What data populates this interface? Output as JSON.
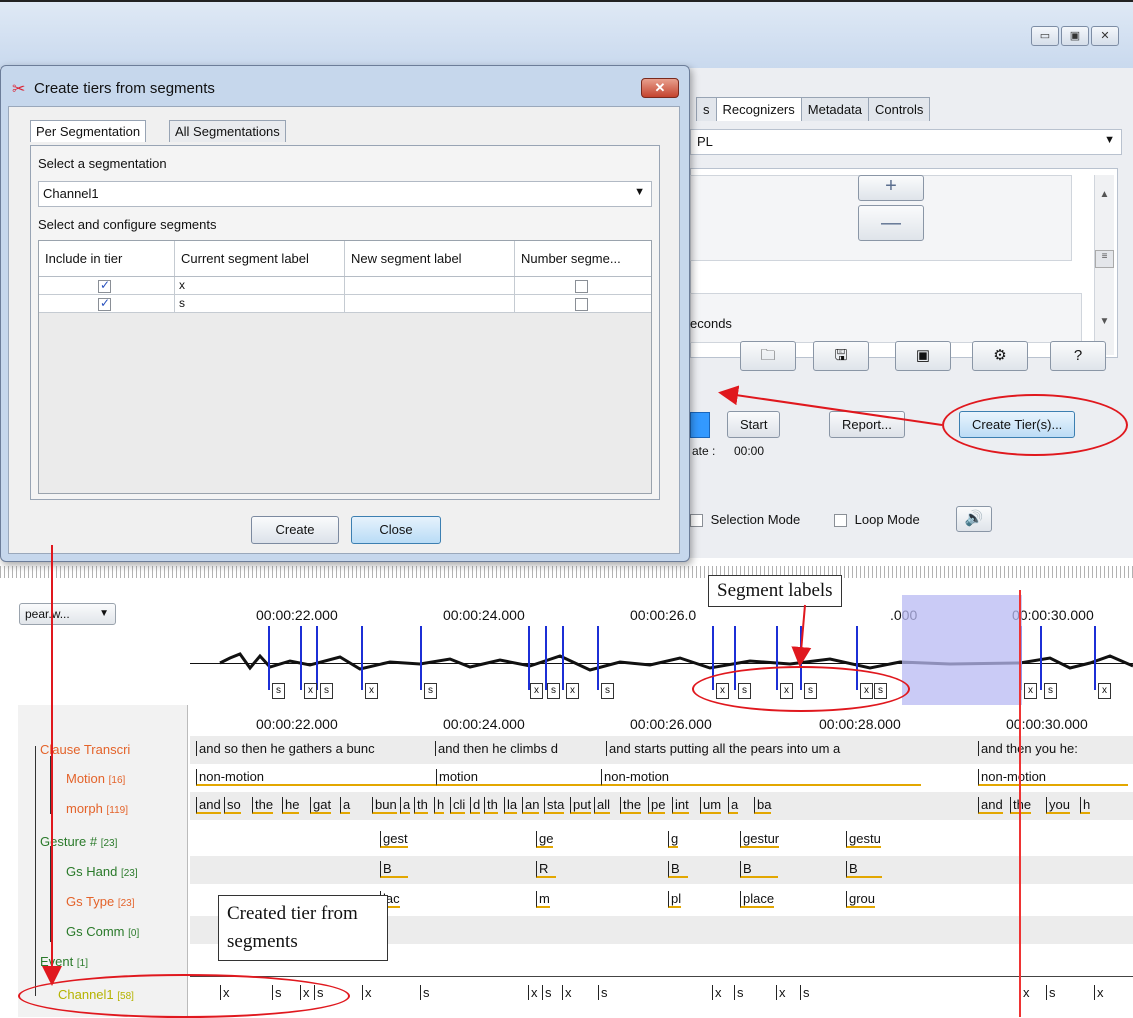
{
  "window_controls": {
    "minimize": "▭",
    "maximize": "▣",
    "close": "✕"
  },
  "main_window": {
    "tabs": [
      "s",
      "Recognizers",
      "Metadata",
      "Controls"
    ],
    "recognizer_select": "PL",
    "plus": "+",
    "minus": "—",
    "seconds_text": "econds",
    "toolbar_icons": [
      "folder-icon",
      "save-icon",
      "window-icon",
      "gear-icon",
      "help-icon"
    ],
    "start_label": "Start",
    "report_label": "Report...",
    "create_tiers_label": "Create Tier(s)...",
    "rate_label": "ate :",
    "rate_value": "00:00",
    "selection_mode_label": "Selection Mode",
    "loop_mode_label": "Loop Mode"
  },
  "dialog": {
    "title": "Create tiers from segments",
    "close": "✕",
    "tabs": [
      "Per Segmentation",
      "All Segmentations"
    ],
    "select_segmentation_label": "Select a segmentation",
    "segmentation_value": "Channel1",
    "configure_label": "Select and configure segments",
    "columns": [
      "Include in tier",
      "Current segment label",
      "New segment label",
      "Number segme..."
    ],
    "rows": [
      {
        "include": true,
        "current": "x",
        "new": "",
        "number": false
      },
      {
        "include": true,
        "current": "s",
        "new": "",
        "number": false
      }
    ],
    "create_label": "Create",
    "close_label": "Close"
  },
  "timeline": {
    "combo_value": "pear.w...",
    "times": [
      "00:00:22.000",
      "00:00:24.000",
      "00:00:26.0",
      ".000",
      "00:00:30.000"
    ],
    "tier_times": [
      "00:00:22.000",
      "00:00:24.000",
      "00:00:26.000",
      "00:00:28.000",
      "00:00:30.000"
    ],
    "wave_segment_labels": [
      "s",
      "x",
      "s",
      "x",
      "s",
      "x",
      "s",
      "x",
      "s",
      "x",
      "s",
      "x",
      "s",
      "x",
      "s",
      "x",
      "s",
      "x"
    ],
    "tiers": [
      {
        "name": "Clause Transcri",
        "count": ""
      },
      {
        "name": "Motion",
        "count": "[16]"
      },
      {
        "name": "morph",
        "count": "[119]"
      },
      {
        "name": "Gesture #",
        "count": "[23]"
      },
      {
        "name": "Gs Hand",
        "count": "[23]"
      },
      {
        "name": "Gs Type",
        "count": "[23]"
      },
      {
        "name": "Gs Comm",
        "count": "[0]"
      },
      {
        "name": "Event",
        "count": "[1]"
      },
      {
        "name": "Channel1",
        "count": "[58]"
      }
    ],
    "clause": [
      "and so then he gathers a bunc",
      "and then he climbs d",
      "and starts putting all the pears into um a",
      "and then you he:"
    ],
    "motion": [
      "non-motion",
      "motion",
      "non-motion",
      "non-motion"
    ],
    "morph": [
      "and",
      "so",
      "the",
      "he",
      "gat",
      "a",
      "bun",
      "a",
      "th",
      "h",
      "cli",
      "d",
      "th",
      "la",
      "an",
      "sta",
      "put",
      "all",
      "the",
      "pe",
      "int",
      "um",
      "a",
      "ba",
      "and",
      "the",
      "you",
      "h"
    ],
    "gesture": [
      "gest",
      "ge",
      "g",
      "gestur",
      "gestu"
    ],
    "gs_hand": [
      "B",
      "R",
      "B",
      "B",
      "B"
    ],
    "gs_type": [
      "lac",
      "m",
      "pl",
      "place",
      "grou"
    ],
    "channel1": [
      "x",
      "s",
      "x",
      "s",
      "x",
      "s",
      "x",
      "s",
      "x",
      "s",
      "x",
      "s",
      "x",
      "s",
      "x",
      "s",
      "x"
    ]
  },
  "annotations": {
    "segment_labels": "Segment labels",
    "created_tier": "Created tier from segments"
  },
  "colors": {
    "accent_red": "#e0181e",
    "segment_blue": "#1c2fd6",
    "selection": "#b8b9f3",
    "tier_name_orange": "#e4632a",
    "tier_name_green": "#2a7a2a"
  }
}
